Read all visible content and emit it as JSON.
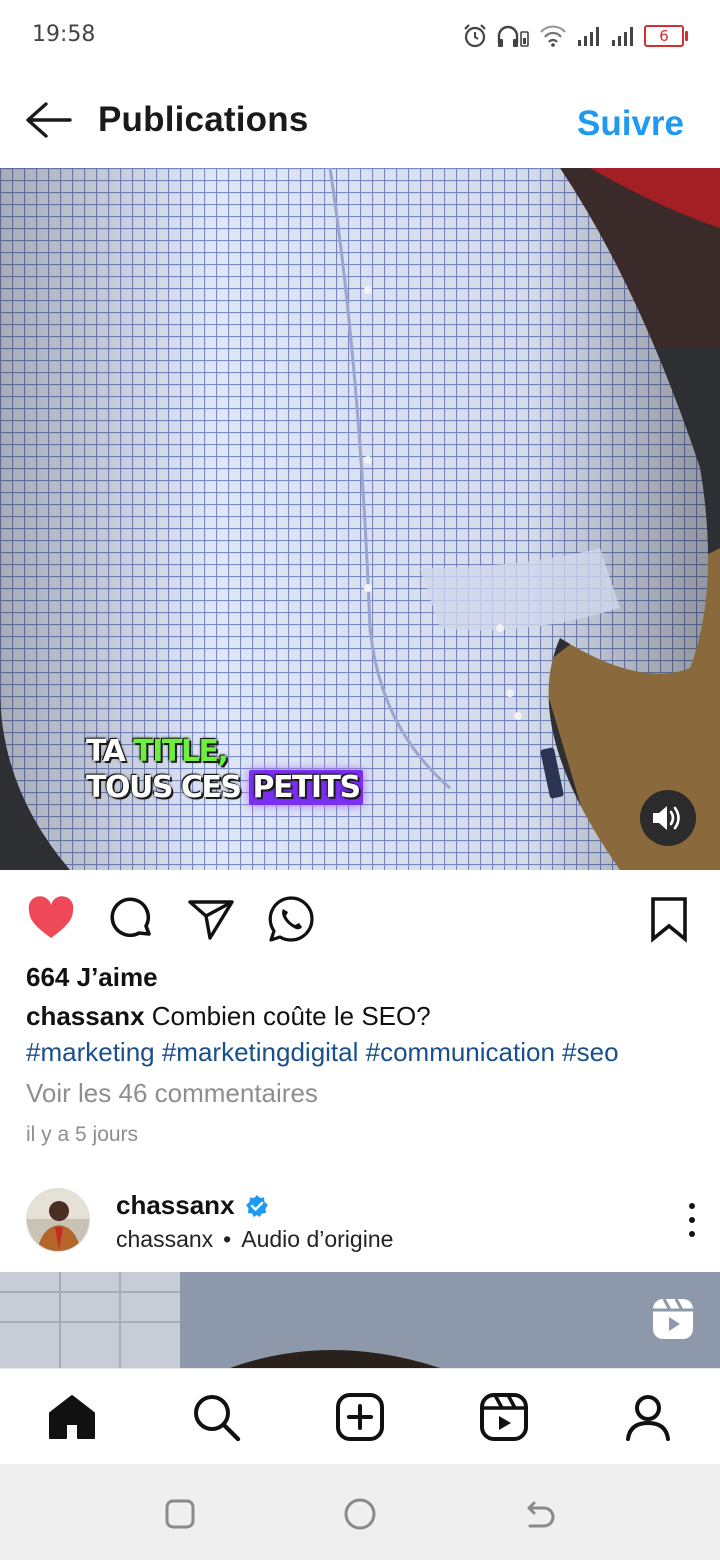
{
  "status_bar": {
    "time": "19:58",
    "battery_level": "6",
    "icons": [
      "alarm-icon",
      "headphones-icon",
      "wifi-icon",
      "signal-icon",
      "signal-icon",
      "battery-icon"
    ]
  },
  "header": {
    "title": "Publications",
    "follow_label": "Suivre",
    "back_icon": "back-arrow-icon"
  },
  "post": {
    "overlay_text": {
      "line1_prefix": "TA ",
      "line1_highlight": "TITLE,",
      "line2_prefix": "TOUS CES ",
      "line2_highlight": "PETITS"
    },
    "likes": "664 J’aime",
    "username": "chassanx",
    "caption_text": " Combien coûte le SEO?",
    "hashtags": "#marketing #marketingdigital #communication #seo",
    "comments_link": "Voir les 46 commentaires",
    "time_ago": "il y a 5 jours",
    "liked": true,
    "colors": {
      "like": "#ed4956",
      "follow": "#1e9bf0",
      "hashtag": "#1a4f8c"
    }
  },
  "next_post": {
    "username": "chassanx",
    "verified": true,
    "subtitle_user": "chassanx",
    "separator": "•",
    "audio_label": "Audio d’origine"
  },
  "bottom_nav": {
    "items": [
      "home-icon",
      "search-icon",
      "create-icon",
      "reels-icon",
      "profile-icon"
    ]
  },
  "system_nav": {
    "items": [
      "recent-apps-icon",
      "home-circle-icon",
      "back-icon"
    ]
  }
}
